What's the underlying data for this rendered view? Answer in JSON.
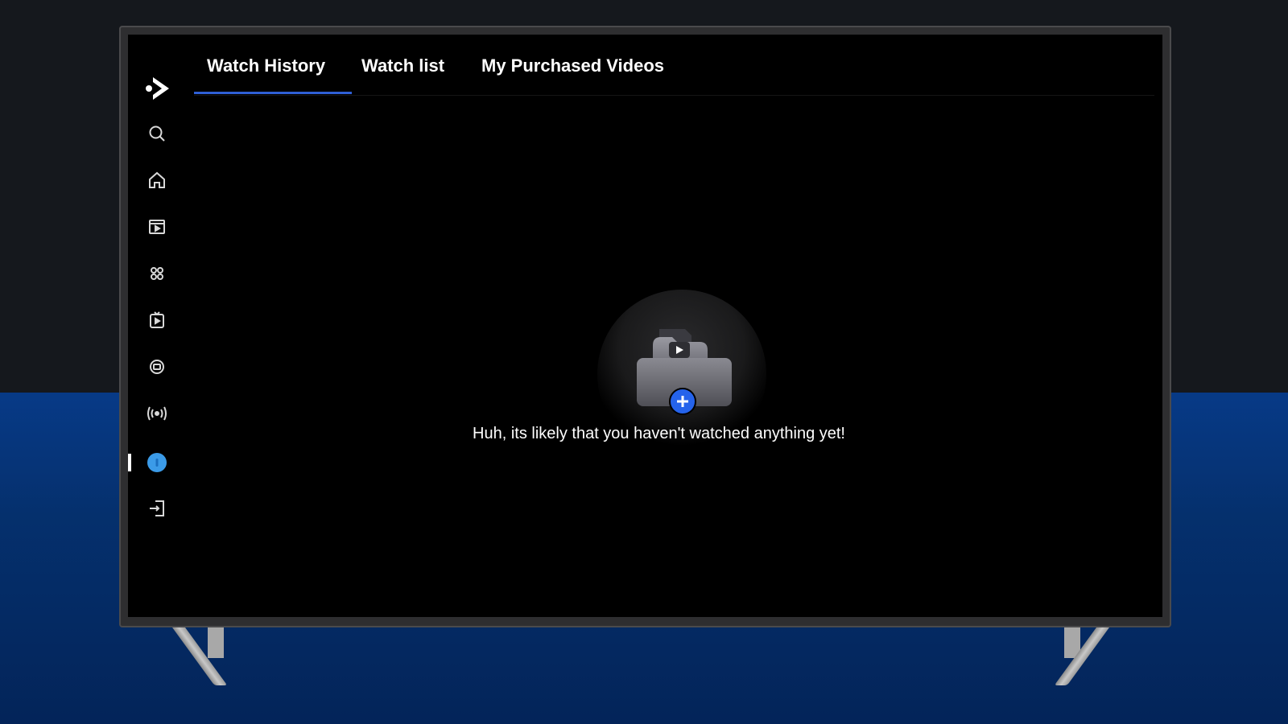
{
  "tabs": [
    {
      "label": "Watch History",
      "active": true
    },
    {
      "label": "Watch list",
      "active": false
    },
    {
      "label": "My Purchased Videos",
      "active": false
    }
  ],
  "sidebar": {
    "logo_icon": "play-logo-icon",
    "items": [
      {
        "icon": "search-icon"
      },
      {
        "icon": "home-icon"
      },
      {
        "icon": "movies-icon"
      },
      {
        "icon": "categories-icon"
      },
      {
        "icon": "shows-icon"
      },
      {
        "icon": "channels-icon"
      },
      {
        "icon": "live-broadcast-icon"
      },
      {
        "icon": "profile-icon",
        "active": true
      },
      {
        "icon": "login-icon"
      }
    ]
  },
  "empty_state": {
    "message": "Huh, its likely that you haven't watched anything yet!",
    "illustration": "folder-play-add-icon"
  },
  "colors": {
    "accent": "#2f5fd6",
    "active_icon": "#3b9be8",
    "screen_bg": "#000000",
    "add_button": "#2563eb"
  }
}
